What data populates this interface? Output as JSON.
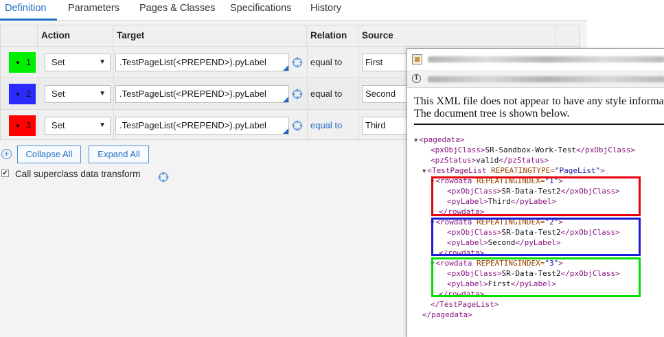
{
  "tabs": [
    {
      "label": "Definition",
      "active": true
    },
    {
      "label": "Parameters",
      "active": false
    },
    {
      "label": "Pages & Classes",
      "active": false
    },
    {
      "label": "Specifications",
      "active": false
    },
    {
      "label": "History",
      "active": false
    }
  ],
  "grid": {
    "headers": {
      "action": "Action",
      "target": "Target",
      "relation": "Relation",
      "source": "Source"
    },
    "rows": [
      {
        "number": "1",
        "color": "#00ee00",
        "action": "Set",
        "target": ".TestPageList(<PREPEND>).pyLabel",
        "relation": "equal to",
        "relation_is_link": false,
        "source": "First"
      },
      {
        "number": "2",
        "color": "#2b2bff",
        "action": "Set",
        "target": ".TestPageList(<PREPEND>).pyLabel",
        "relation": "equal to",
        "relation_is_link": false,
        "source": "Second"
      },
      {
        "number": "3",
        "color": "#ff0000",
        "action": "Set",
        "target": ".TestPageList(<PREPEND>).pyLabel",
        "relation": "equal to",
        "relation_is_link": true,
        "source": "Third"
      }
    ]
  },
  "toolbar": {
    "collapse_label": "Collapse All",
    "expand_label": "Expand All"
  },
  "superclass": {
    "label": "Call superclass data transform",
    "checked": true
  },
  "popup": {
    "message_line1": "This XML file does not appear to have any style informa",
    "message_line2": "The document tree is shown below.",
    "box_colors": {
      "red": "#e8000b",
      "blue": "#1a1ad8",
      "green": "#00dd00"
    },
    "xml": {
      "root_open": "<pagedata>",
      "objclass_open": "<pxObjClass>",
      "objclass_value": "SR-Sandbox-Work-Test",
      "objclass_close": "</pxObjClass>",
      "status_open": "<pzStatus>",
      "status_value": "valid",
      "status_close": "</pzStatus>",
      "list_open_tag": "<TestPageList",
      "list_attr_name": "REPEATINGTYPE=",
      "list_attr_value": "\"PageList\"",
      "list_open_end": ">",
      "rowdata_tag": "<rowdata",
      "rowdata_attr": "REPEATINGINDEX=",
      "rowdata_close": "</rowdata>",
      "row_class_open": "<pxObjClass>",
      "row_class_close": "</pxObjClass>",
      "label_open": "<pyLabel>",
      "label_close": "</pyLabel>",
      "rows": [
        {
          "index": "\"1\"",
          "objclass": "SR-Data-Test2",
          "label": "Third"
        },
        {
          "index": "\"2\"",
          "objclass": "SR-Data-Test2",
          "label": "Second"
        },
        {
          "index": "\"3\"",
          "objclass": "SR-Data-Test2",
          "label": "First"
        }
      ],
      "list_close": "</TestPageList>",
      "root_close": "</pagedata>"
    }
  }
}
